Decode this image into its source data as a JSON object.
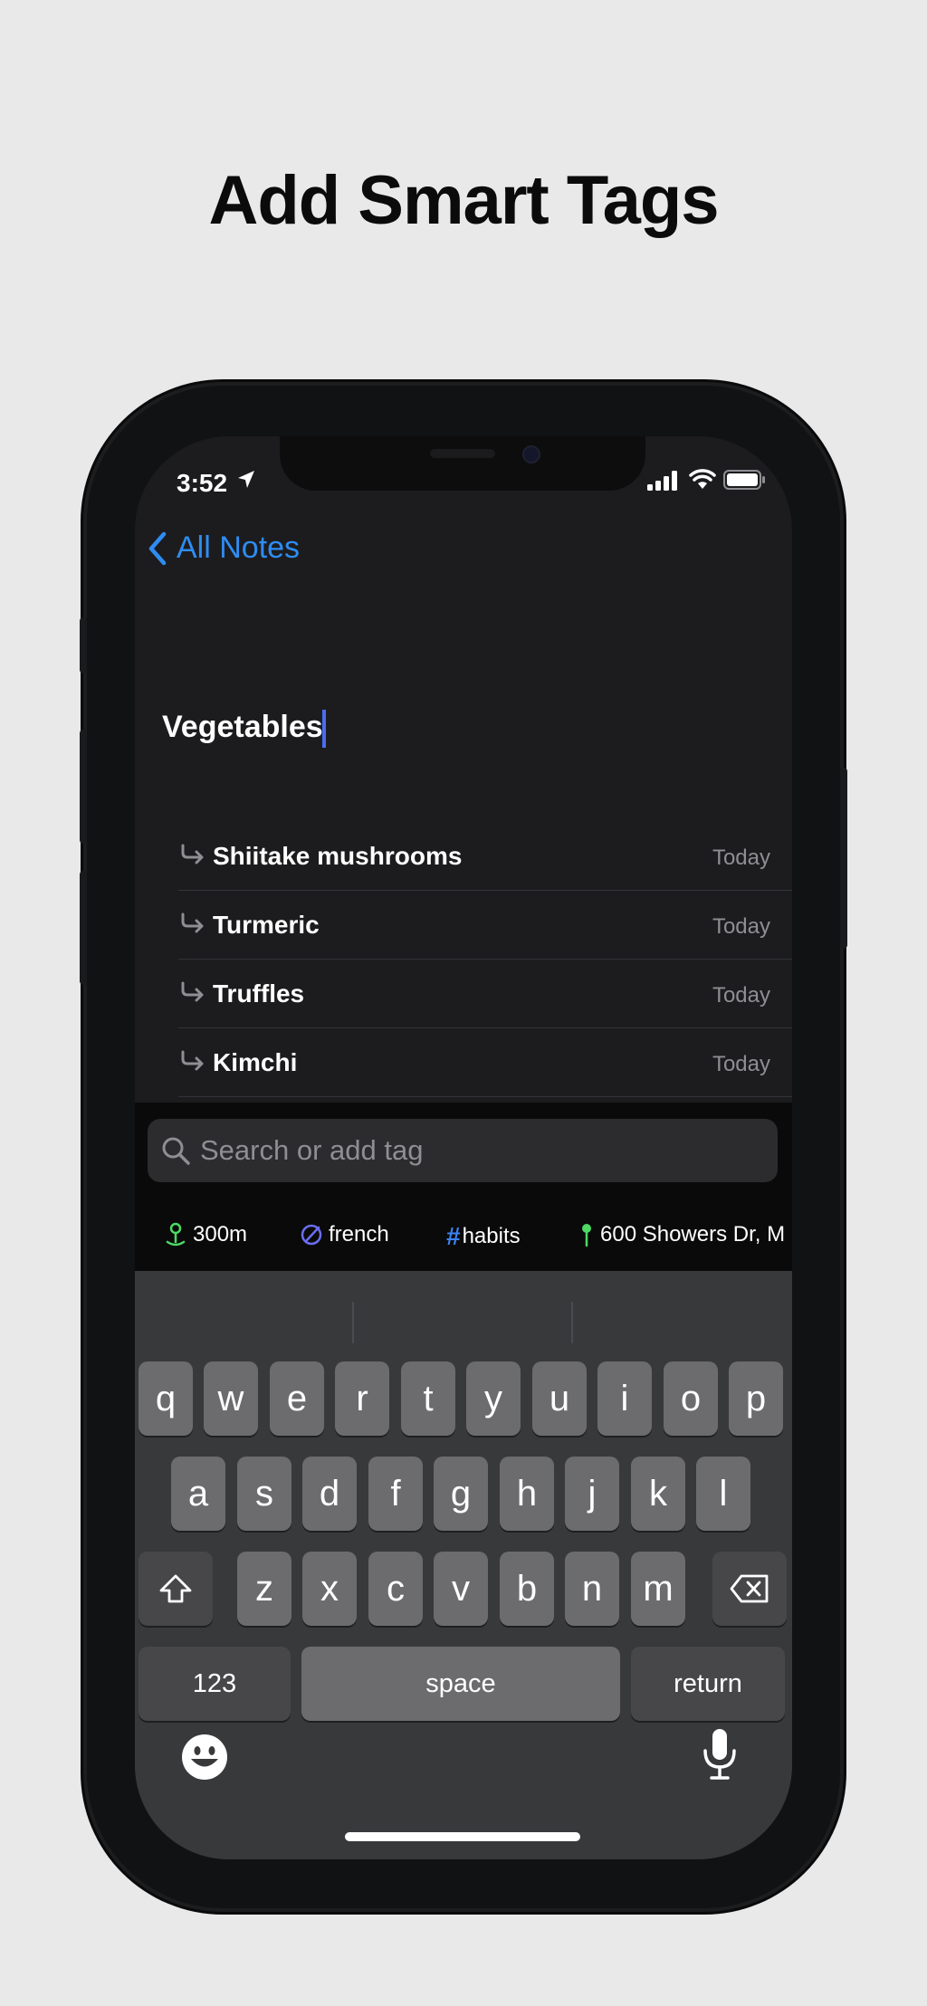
{
  "headline": "Add Smart Tags",
  "status": {
    "time": "3:52"
  },
  "nav": {
    "back_label": "All Notes"
  },
  "note": {
    "title": "Vegetables"
  },
  "list": [
    {
      "name": "Shiitake mushrooms",
      "date": "Today"
    },
    {
      "name": "Turmeric",
      "date": "Today"
    },
    {
      "name": "Truffles",
      "date": "Today"
    },
    {
      "name": "Kimchi",
      "date": "Today"
    }
  ],
  "search": {
    "placeholder": "Search or add tag",
    "value": ""
  },
  "tags": [
    {
      "icon": "location-pin-icon",
      "label": "300m"
    },
    {
      "icon": "style-tag-icon",
      "label": "french"
    },
    {
      "icon": "hashtag-icon",
      "label": "habits"
    },
    {
      "icon": "map-pin-icon",
      "label": "600 Showers Dr, M"
    }
  ],
  "keyboard": {
    "row1": [
      "q",
      "w",
      "e",
      "r",
      "t",
      "y",
      "u",
      "i",
      "o",
      "p"
    ],
    "row2": [
      "a",
      "s",
      "d",
      "f",
      "g",
      "h",
      "j",
      "k",
      "l"
    ],
    "row3": [
      "z",
      "x",
      "c",
      "v",
      "b",
      "n",
      "m"
    ],
    "numbers_label": "123",
    "space_label": "space",
    "return_label": "return"
  },
  "colors": {
    "accent": "#2f8cf2",
    "cursor": "#4b6cf0",
    "background": "#e9e9e9",
    "screen": "#1c1c1e"
  }
}
